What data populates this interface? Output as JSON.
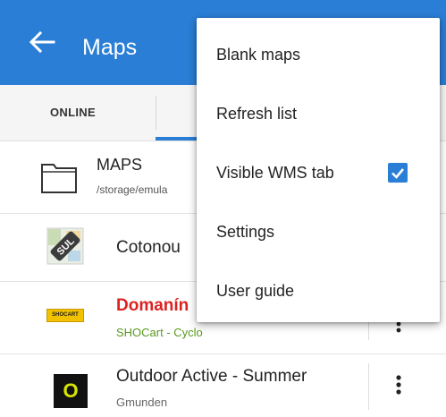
{
  "appbar": {
    "title": "Maps",
    "color": "#2a7ed6"
  },
  "tabs": {
    "online_label": "ONLINE"
  },
  "list": {
    "folder": {
      "title": "MAPS",
      "path": "/storage/emula"
    },
    "items": [
      {
        "title": "Cotonou",
        "icon": "sul-map-thumbnail"
      },
      {
        "title": "Domanín",
        "subtitle": "SHOCart - Cyclo",
        "badge": "SHOCART",
        "title_color": "#dd2222"
      },
      {
        "title": "Outdoor Active - Summer",
        "subtitle": "Gmunden",
        "badge": "O"
      }
    ]
  },
  "menu": {
    "items": [
      {
        "label": "Blank maps"
      },
      {
        "label": "Refresh list"
      },
      {
        "label": "Visible WMS tab",
        "checked": true
      },
      {
        "label": "Settings"
      },
      {
        "label": "User guide"
      }
    ]
  }
}
